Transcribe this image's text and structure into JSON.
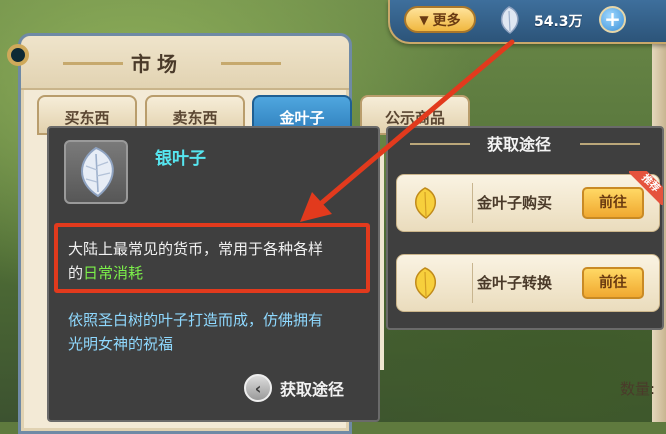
{
  "topbar": {
    "more_label": "更多",
    "currency_value": "54.3万",
    "currency_icon": "silver-leaf-icon",
    "plus_icon": "plus-icon"
  },
  "market": {
    "title": "市场",
    "tabs": [
      "买东西",
      "卖东西",
      "金叶子",
      "公示商品"
    ],
    "active_tab": "金叶子",
    "quantity_label": "数量:"
  },
  "tooltip": {
    "item_name": "银叶子",
    "item_icon": "silver-leaf-icon",
    "desc_line1": "大陆上最常见的货币，常用于各种各样",
    "desc_line2_prefix": "的",
    "desc_line2_highlight": "日常消耗",
    "lore_line1": "依照圣白树的叶子打造而成，仿佛拥有",
    "lore_line2": "光明女神的祝福",
    "obtain_link": "获取途径"
  },
  "obtain_ways": {
    "title": "获取途径",
    "items": [
      {
        "name": "金叶子购买",
        "button": "前往",
        "badge": "推荐",
        "icon": "gold-leaf-icon"
      },
      {
        "name": "金叶子转换",
        "button": "前往",
        "icon": "gold-leaf-icon"
      }
    ]
  },
  "colors": {
    "highlight_box": "#e23a1d",
    "item_name": "#56e6f0",
    "highlight_text": "#7cf04a",
    "lore_text": "#8fd9ff"
  }
}
